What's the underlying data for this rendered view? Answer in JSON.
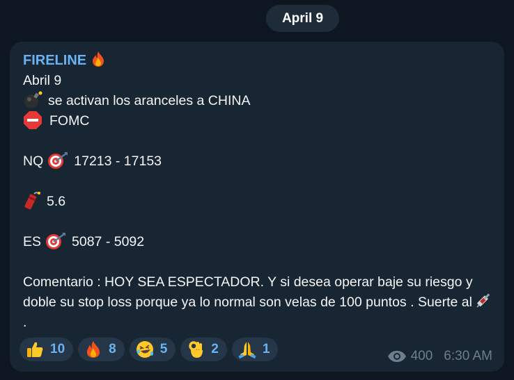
{
  "date_separator": "April 9",
  "message": {
    "author": "FIRELINE",
    "author_icon": "fire-icon",
    "lines": {
      "date": "Abril 9",
      "aranceles": "se activan los aranceles a CHINA",
      "fomc": "FOMC",
      "nq_label": "NQ",
      "nq_range": "17213 - 17153",
      "dynamite_value": "5.6",
      "es_label": "ES",
      "es_range": "5087 - 5092",
      "comment": "Comentario : HOY SEA ESPECTADOR. Y si desea operar baje su riesgo y doble su stop loss porque ya lo normal son velas de 100 puntos . Suerte al",
      "comment_end": "."
    },
    "icons": [
      "bomb-icon",
      "stop-sign-icon",
      "target-icon",
      "dynamite-icon",
      "syringe-icon"
    ],
    "reactions": [
      {
        "icon": "thumbs-up-icon",
        "count": "10"
      },
      {
        "icon": "fire-icon",
        "count": "8"
      },
      {
        "icon": "laughing-face-icon",
        "count": "5"
      },
      {
        "icon": "ok-hand-icon",
        "count": "2"
      },
      {
        "icon": "praying-hands-icon",
        "count": "1"
      }
    ],
    "views": "400",
    "time": "6:30 AM"
  },
  "colors": {
    "background": "#0e1621",
    "bubble": "#182533",
    "accent": "#6ab3f3",
    "meta": "#6d7f8f"
  }
}
